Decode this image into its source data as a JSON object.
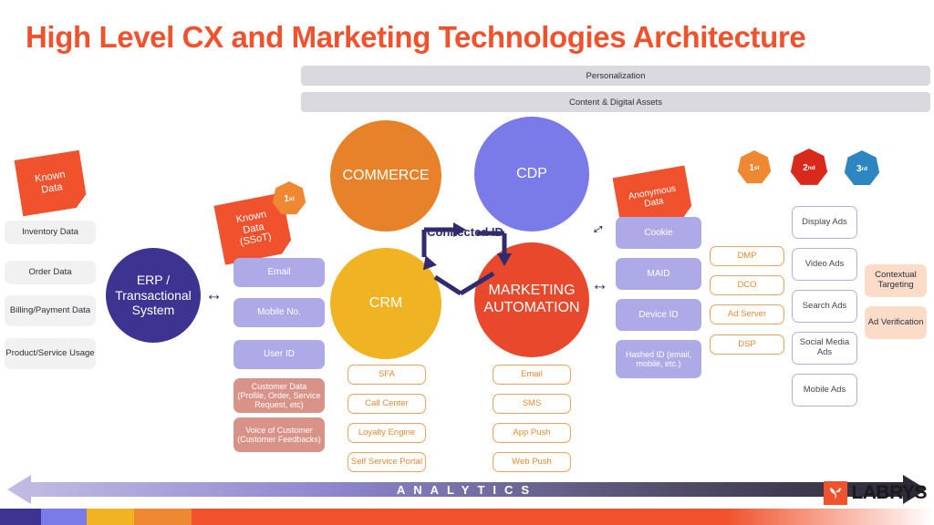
{
  "title": "High Level CX and Marketing Technologies Architecture",
  "banners": [
    {
      "label": "Personalization"
    },
    {
      "label": "Content & Digital Assets"
    }
  ],
  "sticky_notes": [
    {
      "id": "known-data",
      "lines": [
        "Known",
        "Data"
      ]
    },
    {
      "id": "known-data-ssot",
      "lines": [
        "Known",
        "Data",
        "(SSoT)"
      ]
    },
    {
      "id": "anonymous-data",
      "lines": [
        "Anonymous",
        "Data"
      ]
    }
  ],
  "party_badges": [
    {
      "label": "1",
      "suffix": "st",
      "color": "#ef8833",
      "near": "ssot"
    },
    {
      "label": "1",
      "suffix": "st",
      "color": "#ef8833",
      "near": "adtech"
    },
    {
      "label": "2",
      "suffix": "nd",
      "color": "#d9291c",
      "near": "adtech"
    },
    {
      "label": "3",
      "suffix": "rd",
      "color": "#2e86c1",
      "near": "adtech"
    }
  ],
  "source_systems": {
    "items": [
      {
        "label": "Inventory Data"
      },
      {
        "label": "Order Data"
      },
      {
        "label": "Billing/Payment Data"
      },
      {
        "label": "Product/Service Usage"
      }
    ]
  },
  "erp": {
    "label": "ERP / Transactional System",
    "color": "#3d3491"
  },
  "known_identifiers": {
    "items": [
      {
        "label": "Email",
        "style": "purple"
      },
      {
        "label": "Mobile No.",
        "style": "purple"
      },
      {
        "label": "User ID",
        "style": "purple"
      },
      {
        "label": "Customer Data (Profile, Order, Service Request, etc)",
        "style": "salmon"
      },
      {
        "label": "Voice of Customer (Customer Feedbacks)",
        "style": "salmon"
      }
    ]
  },
  "core_platforms": [
    {
      "label": "COMMERCE",
      "color": "#e8822a"
    },
    {
      "label": "CDP",
      "color": "#7a7ae8"
    },
    {
      "label": "CRM",
      "color": "#f0b323"
    },
    {
      "label": "MARKETING AUTOMATION",
      "color": "#e8492c"
    }
  ],
  "connected_id": {
    "label": "Connected ID"
  },
  "crm_channels": {
    "items": [
      {
        "label": "SFA"
      },
      {
        "label": "Call Center"
      },
      {
        "label": "Loyalty Engine"
      },
      {
        "label": "Self Service Portal"
      }
    ]
  },
  "marketing_channels": {
    "items": [
      {
        "label": "Email"
      },
      {
        "label": "SMS"
      },
      {
        "label": "App Push"
      },
      {
        "label": "Web Push"
      }
    ]
  },
  "anonymous_identifiers": {
    "items": [
      {
        "label": "Cookie"
      },
      {
        "label": "MAID"
      },
      {
        "label": "Device ID"
      },
      {
        "label": "Hashed ID (email, mobile, etc.)"
      }
    ]
  },
  "adtech_platforms": {
    "items": [
      {
        "label": "DMP"
      },
      {
        "label": "DCO"
      },
      {
        "label": "Ad Server"
      },
      {
        "label": "DSP"
      }
    ]
  },
  "ad_formats": {
    "items": [
      {
        "label": "Display Ads"
      },
      {
        "label": "Video Ads"
      },
      {
        "label": "Search Ads"
      },
      {
        "label": "Social Media Ads"
      },
      {
        "label": "Mobile Ads"
      }
    ]
  },
  "ad_quality": {
    "items": [
      {
        "label": "Contextual Targeting"
      },
      {
        "label": "Ad Verification"
      }
    ]
  },
  "analytics_bar": {
    "label": "ANALYTICS"
  },
  "brand": {
    "name": "LABRYS"
  },
  "palette": {
    "title_red": "#f0522d",
    "banner_gray": "#d9d9de",
    "erp_purple": "#3d3491",
    "commerce_orange": "#e8822a",
    "cdp_periwinkle": "#7a7ae8",
    "crm_yellow": "#f0b323",
    "ma_red": "#e8492c",
    "identifier_purple": "#aeaae8",
    "salmon": "#d99287",
    "peach": "#fadcc8",
    "outline_orange": "#f2a05c",
    "outline_blue": "#b3b0e4",
    "arrow_navy": "#2f2b6e"
  },
  "bottom_strip_colors": [
    "#3d3491",
    "#7a7ae8",
    "#f0b323",
    "#ef8833",
    "#f0522d"
  ]
}
